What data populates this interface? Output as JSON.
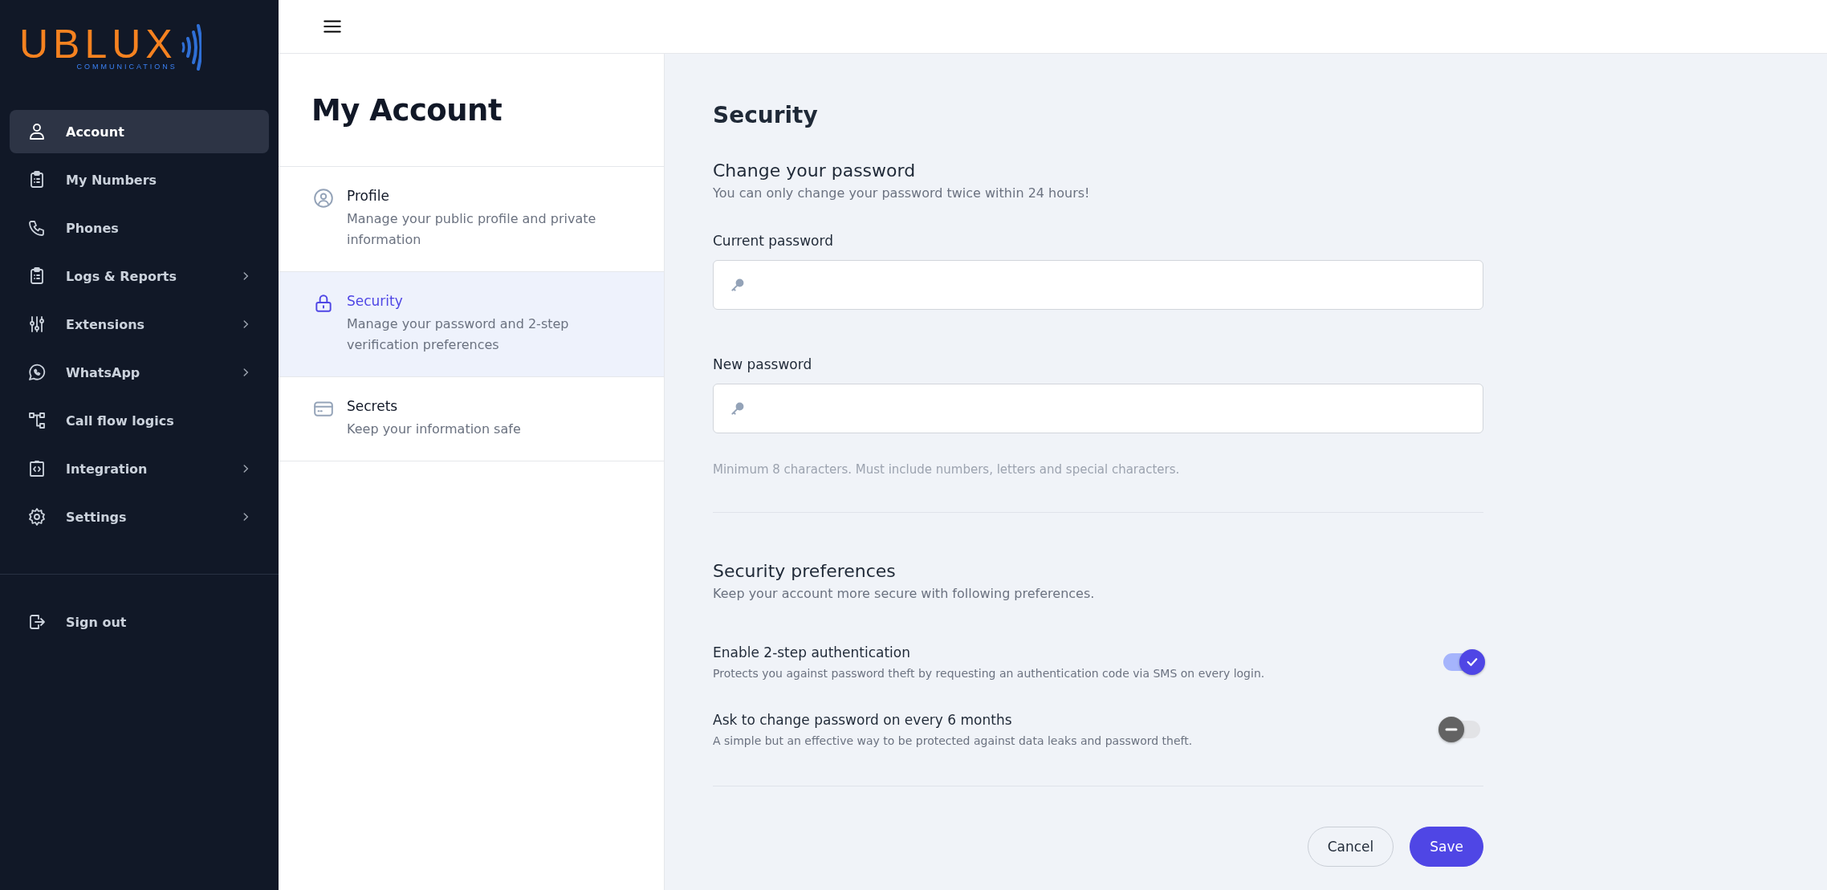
{
  "logo": {
    "name": "UBLUX",
    "tagline": "COMMUNICATIONS"
  },
  "sidebar": {
    "items": [
      {
        "label": "Account",
        "selected": true,
        "has_submenu": false
      },
      {
        "label": "My Numbers",
        "selected": false,
        "has_submenu": false
      },
      {
        "label": "Phones",
        "selected": false,
        "has_submenu": false
      },
      {
        "label": "Logs & Reports",
        "selected": false,
        "has_submenu": true
      },
      {
        "label": "Extensions",
        "selected": false,
        "has_submenu": true
      },
      {
        "label": "WhatsApp",
        "selected": false,
        "has_submenu": true
      },
      {
        "label": "Call flow logics",
        "selected": false,
        "has_submenu": false
      },
      {
        "label": "Integration",
        "selected": false,
        "has_submenu": true
      },
      {
        "label": "Settings",
        "selected": false,
        "has_submenu": true
      }
    ],
    "sign_out": {
      "label": "Sign out"
    }
  },
  "account_panel": {
    "title": "My Account",
    "items": [
      {
        "title": "Profile",
        "description": "Manage your public profile and private information",
        "selected": false
      },
      {
        "title": "Security",
        "description": "Manage your password and 2-step verification preferences",
        "selected": true
      },
      {
        "title": "Secrets",
        "description": "Keep your information safe",
        "selected": false
      }
    ]
  },
  "security": {
    "title": "Security",
    "password": {
      "heading": "Change your password",
      "subtitle": "You can only change your password twice within 24 hours!",
      "fields": [
        {
          "label": "Current password"
        },
        {
          "label": "New password"
        }
      ],
      "hint": "Minimum 8 characters. Must include numbers, letters and special characters."
    },
    "preferences": {
      "heading": "Security preferences",
      "subtitle": "Keep your account more secure with following preferences.",
      "options": [
        {
          "label": "Enable 2-step authentication",
          "description": "Protects you against password theft by requesting an authentication code via SMS on every login.",
          "on": true
        },
        {
          "label": "Ask to change password on every 6 months",
          "description": "A simple but an effective way to be protected against data leaks and password theft.",
          "on": false
        }
      ]
    },
    "buttons": [
      {
        "label": "Cancel",
        "kind": "secondary"
      },
      {
        "label": "Save",
        "kind": "primary"
      }
    ]
  }
}
